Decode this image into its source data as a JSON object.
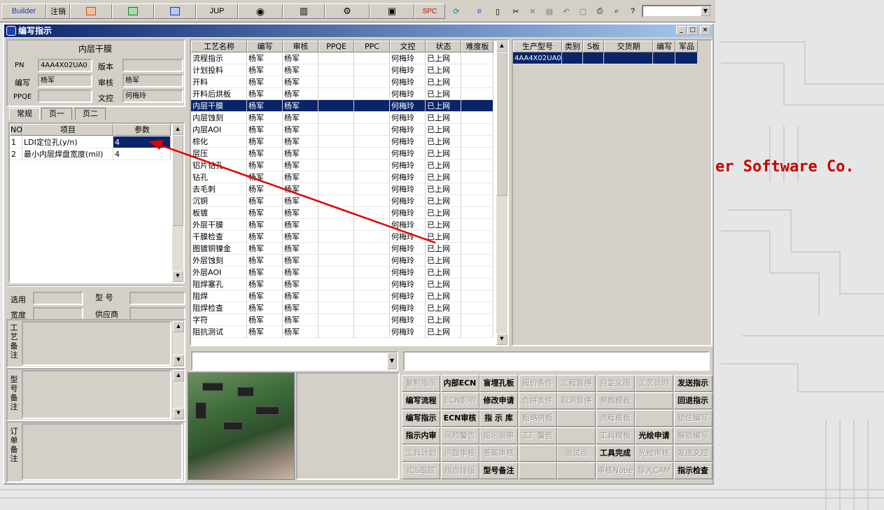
{
  "toolbar": {
    "builder": "Builder",
    "logout": "注销",
    "jup": "JUP",
    "spc": "SPC"
  },
  "window": {
    "title": "编写指示"
  },
  "brand_text": "er Software Co.",
  "info": {
    "layer_title": "内层干膜",
    "pn_label": "PN",
    "pn_value": "4AA4X02UA0",
    "version_label": "版本",
    "version_value": "",
    "writer_label": "编写",
    "writer_value": "杨军",
    "review_label": "审核",
    "review_value": "杨军",
    "ppqe_label": "PPQE",
    "ppqe_value": "",
    "doc_label": "文控",
    "doc_value": "何梅玲"
  },
  "tabs": [
    "常规",
    "页一",
    "页二"
  ],
  "params": {
    "headers": [
      "NO",
      "项目",
      "参数"
    ],
    "rows": [
      {
        "no": "1",
        "item": "LDI定位孔(y/n)",
        "value": "4"
      },
      {
        "no": "2",
        "item": "最小内层焊盘宽度(mil)",
        "value": "4"
      }
    ]
  },
  "select": {
    "use_label": "选用",
    "model_label": "型 号",
    "width_label": "宽度",
    "supplier_label": "供应商"
  },
  "notes": {
    "process": "工艺备注",
    "model": "型号备注",
    "order": "订单备注"
  },
  "process_table": {
    "headers": [
      "工艺名称",
      "编写",
      "审核",
      "PPQE",
      "PPC",
      "文控",
      "状态",
      "难度板"
    ],
    "rows": [
      [
        "流程指示",
        "杨军",
        "杨军",
        "",
        "",
        "何梅玲",
        "已上网",
        ""
      ],
      [
        "计划投料",
        "杨军",
        "杨军",
        "",
        "",
        "何梅玲",
        "已上网",
        ""
      ],
      [
        "开料",
        "杨军",
        "杨军",
        "",
        "",
        "何梅玲",
        "已上网",
        ""
      ],
      [
        "开料后烘板",
        "杨军",
        "杨军",
        "",
        "",
        "何梅玲",
        "已上网",
        ""
      ],
      [
        "内层干膜",
        "杨军",
        "杨军",
        "",
        "",
        "何梅玲",
        "已上网",
        ""
      ],
      [
        "内层蚀刻",
        "杨军",
        "杨军",
        "",
        "",
        "何梅玲",
        "已上网",
        ""
      ],
      [
        "内层AOI",
        "杨军",
        "杨军",
        "",
        "",
        "何梅玲",
        "已上网",
        ""
      ],
      [
        "棕化",
        "杨军",
        "杨军",
        "",
        "",
        "何梅玲",
        "已上网",
        ""
      ],
      [
        "层压",
        "杨军",
        "杨军",
        "",
        "",
        "何梅玲",
        "已上网",
        ""
      ],
      [
        "铝片钻孔",
        "杨军",
        "杨军",
        "",
        "",
        "何梅玲",
        "已上网",
        ""
      ],
      [
        "钻孔",
        "杨军",
        "杨军",
        "",
        "",
        "何梅玲",
        "已上网",
        ""
      ],
      [
        "去毛刺",
        "杨军",
        "杨军",
        "",
        "",
        "何梅玲",
        "已上网",
        ""
      ],
      [
        "沉铜",
        "杨军",
        "杨军",
        "",
        "",
        "何梅玲",
        "已上网",
        ""
      ],
      [
        "板镀",
        "杨军",
        "杨军",
        "",
        "",
        "何梅玲",
        "已上网",
        ""
      ],
      [
        "外层干膜",
        "杨军",
        "杨军",
        "",
        "",
        "何梅玲",
        "已上网",
        ""
      ],
      [
        "干膜检查",
        "杨军",
        "杨军",
        "",
        "",
        "何梅玲",
        "已上网",
        ""
      ],
      [
        "图镀铜镍金",
        "杨军",
        "杨军",
        "",
        "",
        "何梅玲",
        "已上网",
        ""
      ],
      [
        "外层蚀刻",
        "杨军",
        "杨军",
        "",
        "",
        "何梅玲",
        "已上网",
        ""
      ],
      [
        "外层AOI",
        "杨军",
        "杨军",
        "",
        "",
        "何梅玲",
        "已上网",
        ""
      ],
      [
        "阻焊塞孔",
        "杨军",
        "杨军",
        "",
        "",
        "何梅玲",
        "已上网",
        ""
      ],
      [
        "阻焊",
        "杨军",
        "杨军",
        "",
        "",
        "何梅玲",
        "已上网",
        ""
      ],
      [
        "阻焊检查",
        "杨军",
        "杨军",
        "",
        "",
        "何梅玲",
        "已上网",
        ""
      ],
      [
        "字符",
        "杨军",
        "杨军",
        "",
        "",
        "何梅玲",
        "已上网",
        ""
      ],
      [
        "阻抗测试",
        "杨军",
        "杨军",
        "",
        "",
        "何梅玲",
        "已上网",
        ""
      ]
    ]
  },
  "product_table": {
    "headers": [
      "生产型号",
      "类别",
      "S板",
      "交货期",
      "编写",
      "军品"
    ],
    "rows": [
      [
        "4AA4X02UA0",
        "",
        "",
        "",
        "",
        ""
      ]
    ]
  },
  "buttons": [
    [
      "复制指示",
      "内部ECN",
      "盲埋孔板",
      "报价条件",
      "工程暂停",
      "自定义图",
      "工艺计时",
      "发送指示"
    ],
    [
      "编写流程",
      "ECN影响",
      "修改申请",
      "合拼条件",
      "取消暂停",
      "参数模板",
      "",
      "回退指示"
    ],
    [
      "编写指示",
      "ECN审核",
      "指 示 库",
      "粗略拼板",
      "",
      "流程模板",
      "",
      "锁住编写"
    ],
    [
      "指示内审",
      "风险警告",
      "指示退审",
      "工厂警告",
      "",
      "工具模板",
      "光绘申请",
      "解锁编写"
    ],
    [
      "工具计划",
      "问题审核",
      "答案审核",
      "",
      "测试点",
      "工具完成",
      "光绘审核",
      "发送文控"
    ],
    [
      "ICS跟踪",
      "组合排版",
      "型号备注",
      "",
      "",
      "审核Nope",
      "导入CAM",
      "指示检查"
    ]
  ],
  "button_states": [
    [
      "dis",
      "bold",
      "bold",
      "dis",
      "dis",
      "dis",
      "dis",
      "bold"
    ],
    [
      "bold",
      "dis",
      "bold",
      "dis",
      "dis",
      "dis",
      "dis",
      "bold"
    ],
    [
      "bold",
      "bold",
      "bold",
      "dis",
      "dis",
      "dis",
      "dis",
      "dis"
    ],
    [
      "bold",
      "dis",
      "dis",
      "dis",
      "dis",
      "dis",
      "bold",
      "dis"
    ],
    [
      "dis",
      "dis",
      "dis",
      "dis",
      "dis",
      "bold",
      "dis",
      "dis"
    ],
    [
      "dis",
      "dis",
      "bold",
      "dis",
      "dis",
      "dis",
      "dis",
      "bold"
    ]
  ],
  "selected_process_row": 4,
  "colors": {
    "selection": "#0a246a",
    "arrow": "#e00000",
    "face": "#d4d0c8"
  }
}
